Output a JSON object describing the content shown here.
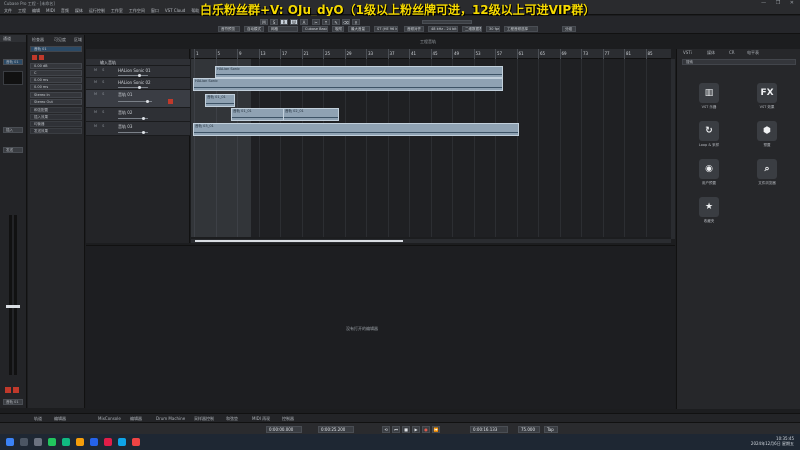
{
  "banner": "白乐粉丝群+V: OJu_dyO（1级以上粉丝牌可进，12级以上可进VIP群）",
  "window": {
    "title": "Cubase Pro 工程 - [未命名]",
    "controls": "— ❐ ✕"
  },
  "menu": [
    "文件",
    "工程",
    "编辑",
    "MIDI",
    "音频",
    "媒体",
    "运行控制",
    "工作室",
    "工作空间",
    "窗口",
    "VST Cloud",
    "帮助"
  ],
  "toolbar": {
    "buttons": [
      "M",
      "S",
      "R",
      "W",
      "A",
      "✂",
      "⤒",
      "✎",
      "⌫",
      "⚲"
    ],
    "fields": [
      "音符预览",
      "自动模式",
      "网格",
      "Cubase Basic",
      "吸附",
      "最大音量",
      "ST (HE 96 khz)",
      "音频对齐",
      "48 kHz - 24 bit",
      "二维数据表",
      "30 fps",
      "工程音频选择",
      "分组"
    ],
    "center_label": "工程音轨"
  },
  "left_strip": {
    "header": "通道",
    "box1": "音轨 01",
    "box2": "插入",
    "box3": "发送"
  },
  "inspector": {
    "tabs": [
      "检查器",
      "可见度",
      "区域"
    ],
    "track": "音轨 01",
    "volume": "0.00 dB",
    "pan": "C",
    "delay": "0.00 ms",
    "input": "Stereo In",
    "output": "Stereo Out",
    "sections": [
      "和弦配置",
      "插入效果",
      "均衡器",
      "发送效果"
    ]
  },
  "tracks": [
    {
      "name": "输入音轨",
      "sel": false
    },
    {
      "name": "HALion Sonic 01",
      "sel": false
    },
    {
      "name": "HALion Sonic 02",
      "sel": false
    },
    {
      "name": "音轨 01",
      "sel": true
    },
    {
      "name": "音轨 02",
      "sel": false
    },
    {
      "name": "音轨 03",
      "sel": false
    }
  ],
  "ruler": [
    "1",
    "5",
    "9",
    "13",
    "17",
    "21",
    "25",
    "29",
    "33",
    "37",
    "41",
    "45",
    "49",
    "53",
    "57",
    "61",
    "65",
    "69",
    "73",
    "77",
    "81",
    "85"
  ],
  "clips": {
    "hs1": "HALion Sonic",
    "hs2": "HALion Sonic",
    "a1": "音轨 01_01",
    "a2": "音轨 02_01",
    "a3": "音轨 03_01"
  },
  "lower_zone_msg": "没有打开的编辑器",
  "right_panel": {
    "tabs": [
      "VSTi",
      "媒体",
      "CR",
      "电平表"
    ],
    "search": "搜索",
    "tiles": [
      {
        "glyph": "▥",
        "label": "VST 乐器"
      },
      {
        "glyph": "FX",
        "label": "VST 效果"
      },
      {
        "glyph": "↻",
        "label": "Loop & 采样"
      },
      {
        "glyph": "⬢",
        "label": "预置"
      },
      {
        "glyph": "◉",
        "label": "用户预置"
      },
      {
        "glyph": "⌕",
        "label": "文件浏览器"
      },
      {
        "glyph": "★",
        "label": "收藏夹"
      }
    ]
  },
  "bottom_tabs": [
    "轨道",
    "编辑器",
    "MixConsole",
    "编辑器",
    "Drum Machine",
    "采样器控制",
    "和弦垫",
    "MIDI 再现",
    "控制器"
  ],
  "transport": {
    "left_time": "0:00:00.000",
    "pos_a": "0:00:25.200",
    "main_time": "0:00:16.133",
    "tempo": "75.000",
    "sig": "Tap",
    "buttons": [
      "⏮",
      "⏪",
      "⏩",
      "⏺",
      "▶",
      "■",
      "●",
      "⟲"
    ]
  },
  "taskbar": {
    "time": "10:35:45",
    "date": "2024年12月6日 星期五"
  },
  "colors": {
    "clip": "#8fa2b3",
    "accent": "#f5d900",
    "record": "#c0392b"
  }
}
